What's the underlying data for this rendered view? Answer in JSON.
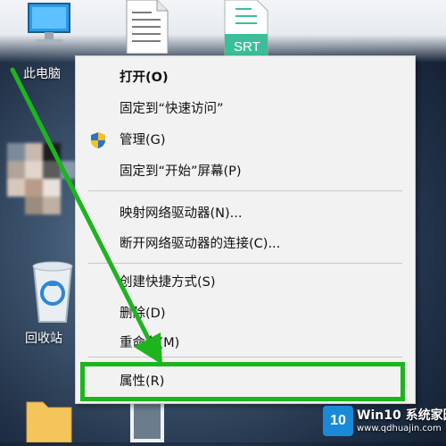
{
  "desktop": {
    "icons": {
      "this_pc": {
        "label": "此电脑"
      },
      "srt_file": {
        "badge": "SRT"
      },
      "recycle_bin": {
        "label": "回收站"
      }
    }
  },
  "context_menu": {
    "items": [
      {
        "label": "打开(O)",
        "bold": true
      },
      {
        "label": "固定到“快速访问”"
      },
      {
        "label": "管理(G)",
        "icon": "shield-icon"
      },
      {
        "label": "固定到“开始”屏幕(P)"
      },
      {
        "label": "映射网络驱动器(N)..."
      },
      {
        "label": "断开网络驱动器的连接(C)..."
      },
      {
        "label": "创建快捷方式(S)"
      },
      {
        "label": "删除(D)"
      },
      {
        "label": "重命名(M)"
      },
      {
        "label": "属性(R)"
      }
    ]
  },
  "annotation": {
    "color": "#1eb41e"
  },
  "watermark": {
    "logo_text": "10",
    "title": "Win10 系统家园",
    "url": "www.qdhuajin.com"
  }
}
